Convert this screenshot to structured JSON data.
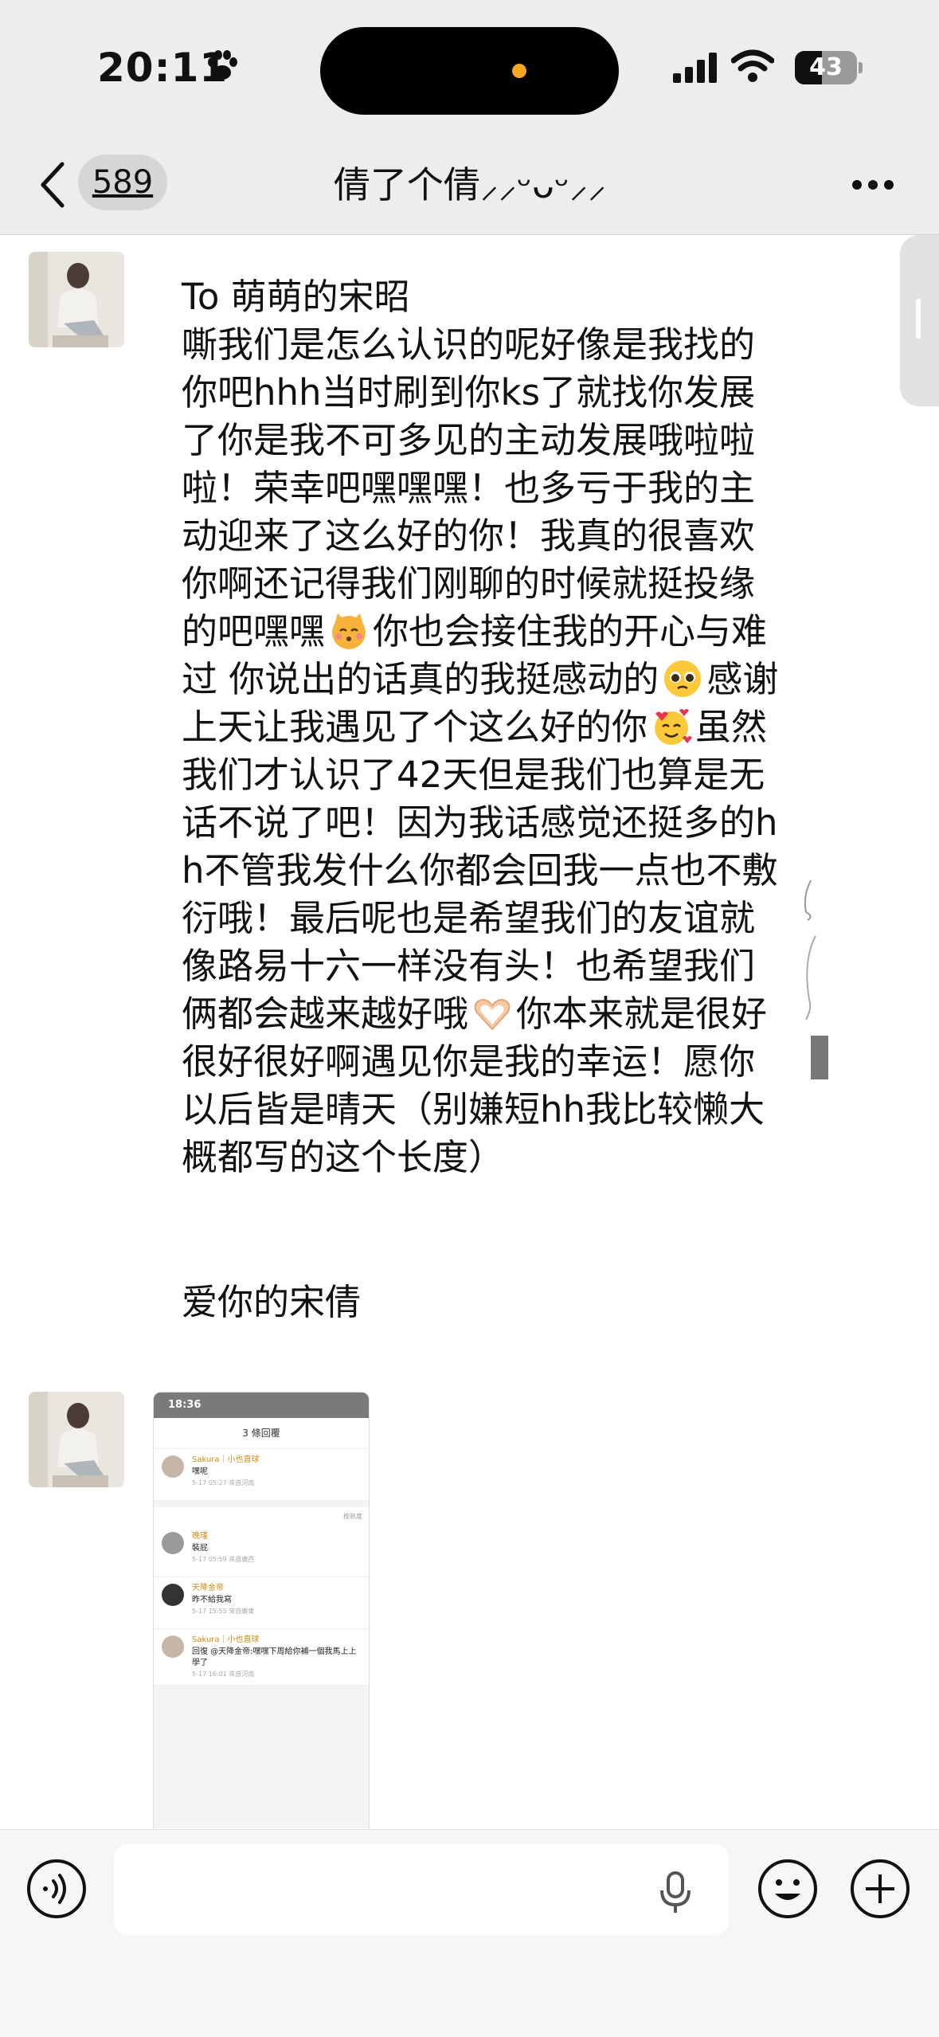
{
  "status_bar": {
    "time": "20:11",
    "battery": "43"
  },
  "nav": {
    "unread_count": "589",
    "title": "倩了个倩⸝⸝ᵕᴗᵕ⸝⸝"
  },
  "messages": [
    {
      "type": "text",
      "segments": [
        "To 萌萌的宋昭\n嘶我们是怎么认识的呢好像是我找的你吧hhh当时刷到你ks了就找你发展了你是我不可多见的主动发展哦啦啦啦！荣幸吧嘿嘿嘿！也多亏于我的主动迎来了这么好的你！我真的很喜欢你啊还记得我们刚聊的时候就挺投缘的吧嘿嘿",
        "你也会接住我的开心与难过 你说出的话真的我挺感动的",
        "感谢上天让我遇见了个这么好的你",
        "虽然我们才认识了42天但是我们也算是无话不说了吧！因为我话感觉还挺多的hh不管我发什么你都会回我一点也不敷衍哦！最后呢也是希望我们的友谊就像路易十六一样没有头！也希望我们俩都会越来越好哦",
        "你本来就是很好很好很好啊遇见你是我的幸运！愿你以后皆是晴天（别嫌短hh我比较懒大概都写的这个长度）"
      ],
      "emojis": [
        "kissing-cat-emoji",
        "pleading-face-emoji",
        "smiling-hearts-emoji",
        "heart-hands-emoji"
      ],
      "signoff": "爱你的宋倩"
    },
    {
      "type": "image",
      "screenshot": {
        "time": "18:36",
        "header": "3 條回覆",
        "comments": [
          {
            "name": "Sakura｜小也直球",
            "body": "嘿呢",
            "meta": "5-17 05:27 來自河南"
          },
          {
            "name": "晚瑾",
            "body": "裝屁",
            "meta": "5-17 05:59 來自廣西"
          },
          {
            "name": "天降金帝",
            "body": "昨不給我寫",
            "meta": "5-17 15:55 來自廣東"
          },
          {
            "name": "Sakura｜小也直球",
            "body": "回復 @天降金帝:嘿嘿下周給你補一個我馬上上學了",
            "meta": "5-17 16:01 來自河南"
          }
        ],
        "sort_label": "按熱度"
      }
    }
  ],
  "colors": {
    "nav_bg": "#ededed",
    "chat_bg": "#ffffff",
    "input_bg": "#f6f6f6"
  }
}
